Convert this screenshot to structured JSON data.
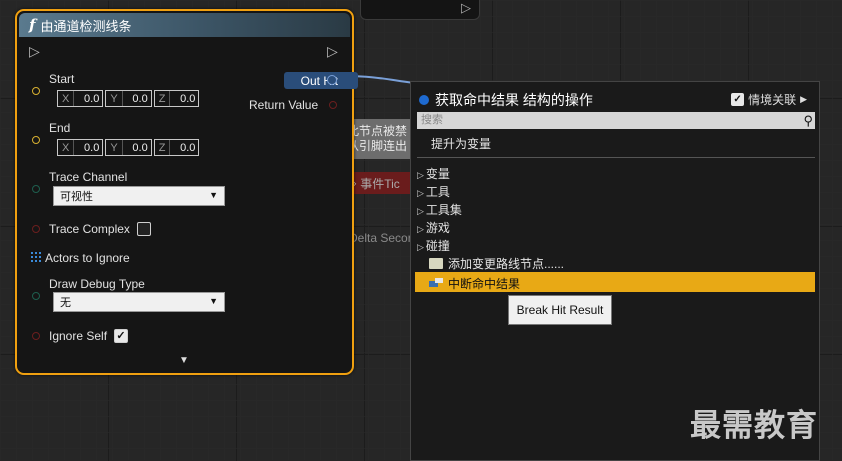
{
  "node": {
    "title": "由通道检测线条",
    "function_icon": "f",
    "start_label": "Start",
    "start": {
      "x_label": "X",
      "x": "0.0",
      "y_label": "Y",
      "y": "0.0",
      "z_label": "Z",
      "z": "0.0"
    },
    "end_label": "End",
    "end": {
      "x_label": "X",
      "x": "0.0",
      "y_label": "Y",
      "y": "0.0",
      "z_label": "Z",
      "z": "0.0"
    },
    "trace_channel_label": "Trace Channel",
    "trace_channel_value": "可视性",
    "trace_complex_label": "Trace Complex",
    "actors_to_ignore_label": "Actors to Ignore",
    "draw_debug_type_label": "Draw Debug Type",
    "draw_debug_type_value": "无",
    "ignore_self_label": "Ignore Self",
    "out_hit_label": "Out Hit",
    "return_value_label": "Return Value",
    "accent": "#f0a010"
  },
  "background": {
    "tooltip_line1": "此节点被禁",
    "tooltip_line2": "从引脚连出",
    "event_tick": "事件Tic",
    "delta": "Delta Secor"
  },
  "menu": {
    "title": "获取命中结果 结构的操作",
    "context_label": "情境关联",
    "search_placeholder": "搜索",
    "promote": "提升为变量",
    "categories": [
      "变量",
      "工具",
      "工具集",
      "游戏",
      "碰撞"
    ],
    "add_reroute": "添加变更路线节点......",
    "break_hit": "中断命中结果",
    "selected_color": "#e8a915"
  },
  "tooltip": "Break Hit Result",
  "watermark": "最需教育"
}
